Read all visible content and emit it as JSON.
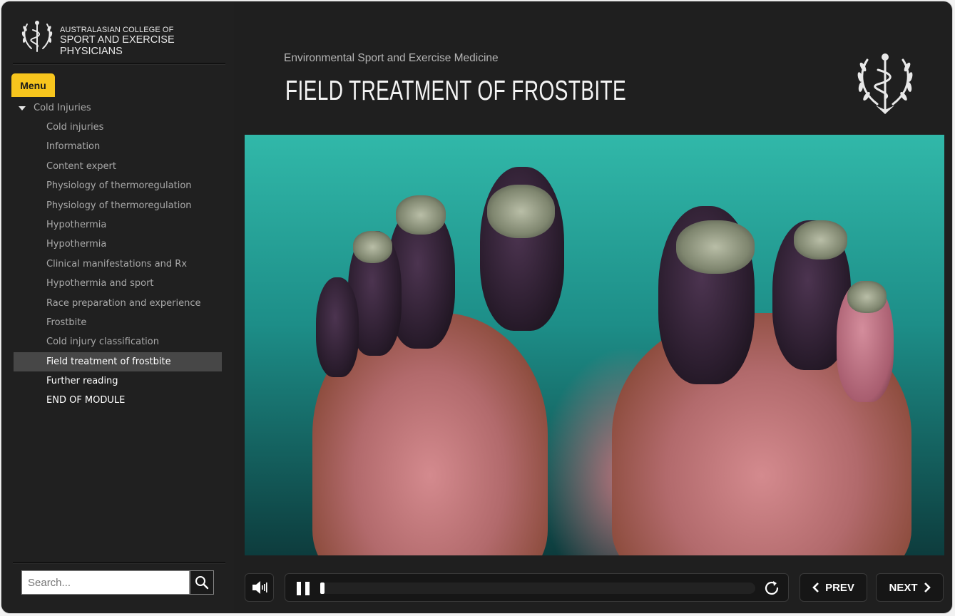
{
  "org": {
    "line1": "AUSTRALASIAN COLLEGE OF",
    "line2": "SPORT AND EXERCISE PHYSICIANS"
  },
  "sidebar": {
    "menu_tab": "Menu",
    "section": "Cold Injuries",
    "items": [
      {
        "label": "Cold injuries"
      },
      {
        "label": "Information"
      },
      {
        "label": "Content expert"
      },
      {
        "label": "Physiology of thermoregulation"
      },
      {
        "label": "Physiology of thermoregulation"
      },
      {
        "label": "Hypothermia"
      },
      {
        "label": "Hypothermia"
      },
      {
        "label": "Clinical manifestations and Rx"
      },
      {
        "label": "Hypothermia and sport"
      },
      {
        "label": "Race preparation and experience"
      },
      {
        "label": "Frostbite"
      },
      {
        "label": "Cold injury classification"
      },
      {
        "label": "Field treatment of frostbite"
      },
      {
        "label": "Further reading"
      },
      {
        "label": "END OF MODULE"
      }
    ],
    "active_item": "Field treatment of frostbite",
    "search": {
      "placeholder": "Search..."
    }
  },
  "header": {
    "course": "Environmental Sport and Exercise Medicine",
    "title": "FIELD TREATMENT OF FROSTBITE"
  },
  "player": {
    "progress": 0.01,
    "prev_label": "PREV",
    "next_label": "NEXT"
  },
  "colors": {
    "accent": "#f7c51d",
    "background": "#1f1f1f",
    "active_item_bg": "#474747"
  }
}
